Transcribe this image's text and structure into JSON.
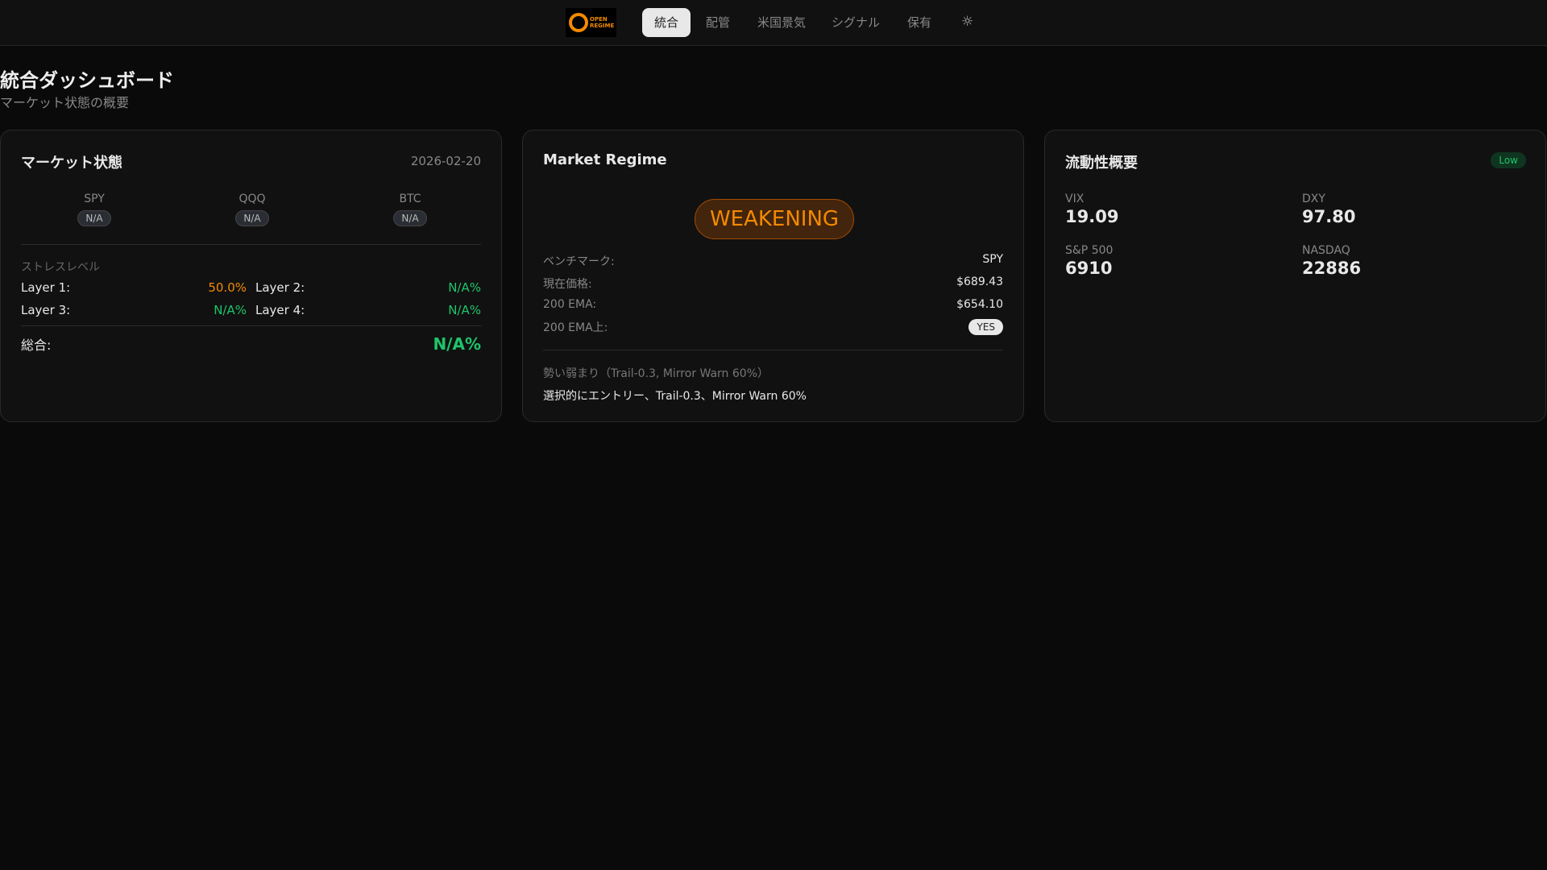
{
  "nav": {
    "logo_text": "OPEN REGIME",
    "tabs": [
      "統合",
      "配管",
      "米国景気",
      "シグナル",
      "保有"
    ],
    "active_tab": 0,
    "theme_icon": "sun-icon"
  },
  "page": {
    "title": "統合ダッシュボード",
    "subtitle": "マーケット状態の概要"
  },
  "market_state": {
    "title": "マーケット状態",
    "date": "2026-02-20",
    "assets": [
      {
        "name": "SPY",
        "status": "N/A"
      },
      {
        "name": "QQQ",
        "status": "N/A"
      },
      {
        "name": "BTC",
        "status": "N/A"
      }
    ],
    "stress_label": "ストレスレベル",
    "layers": [
      {
        "label": "Layer 1:",
        "value": "50.0%"
      },
      {
        "label": "Layer 2:",
        "value": "N/A%"
      },
      {
        "label": "Layer 3:",
        "value": "N/A%"
      },
      {
        "label": "Layer 4:",
        "value": "N/A%"
      }
    ],
    "total_label": "総合:",
    "total_value": "N/A%"
  },
  "regime": {
    "title": "Market Regime",
    "state": "WEAKENING",
    "rows": [
      {
        "label": "ベンチマーク:",
        "value": "SPY"
      },
      {
        "label": "現在価格:",
        "value": "$689.43"
      },
      {
        "label": "200 EMA:",
        "value": "$654.10"
      },
      {
        "label": "200 EMA上:",
        "value": "YES"
      }
    ],
    "note": "勢い弱まり（Trail-0.3, Mirror Warn 60%）",
    "action": "選択的にエントリー、Trail-0.3、Mirror Warn 60%"
  },
  "liquidity": {
    "title": "流動性概要",
    "badge": "Low",
    "items": [
      {
        "label": "VIX",
        "value": "19.09"
      },
      {
        "label": "DXY",
        "value": "97.80"
      },
      {
        "label": "S&P 500",
        "value": "6910"
      },
      {
        "label": "NASDAQ",
        "value": "22886"
      }
    ]
  }
}
